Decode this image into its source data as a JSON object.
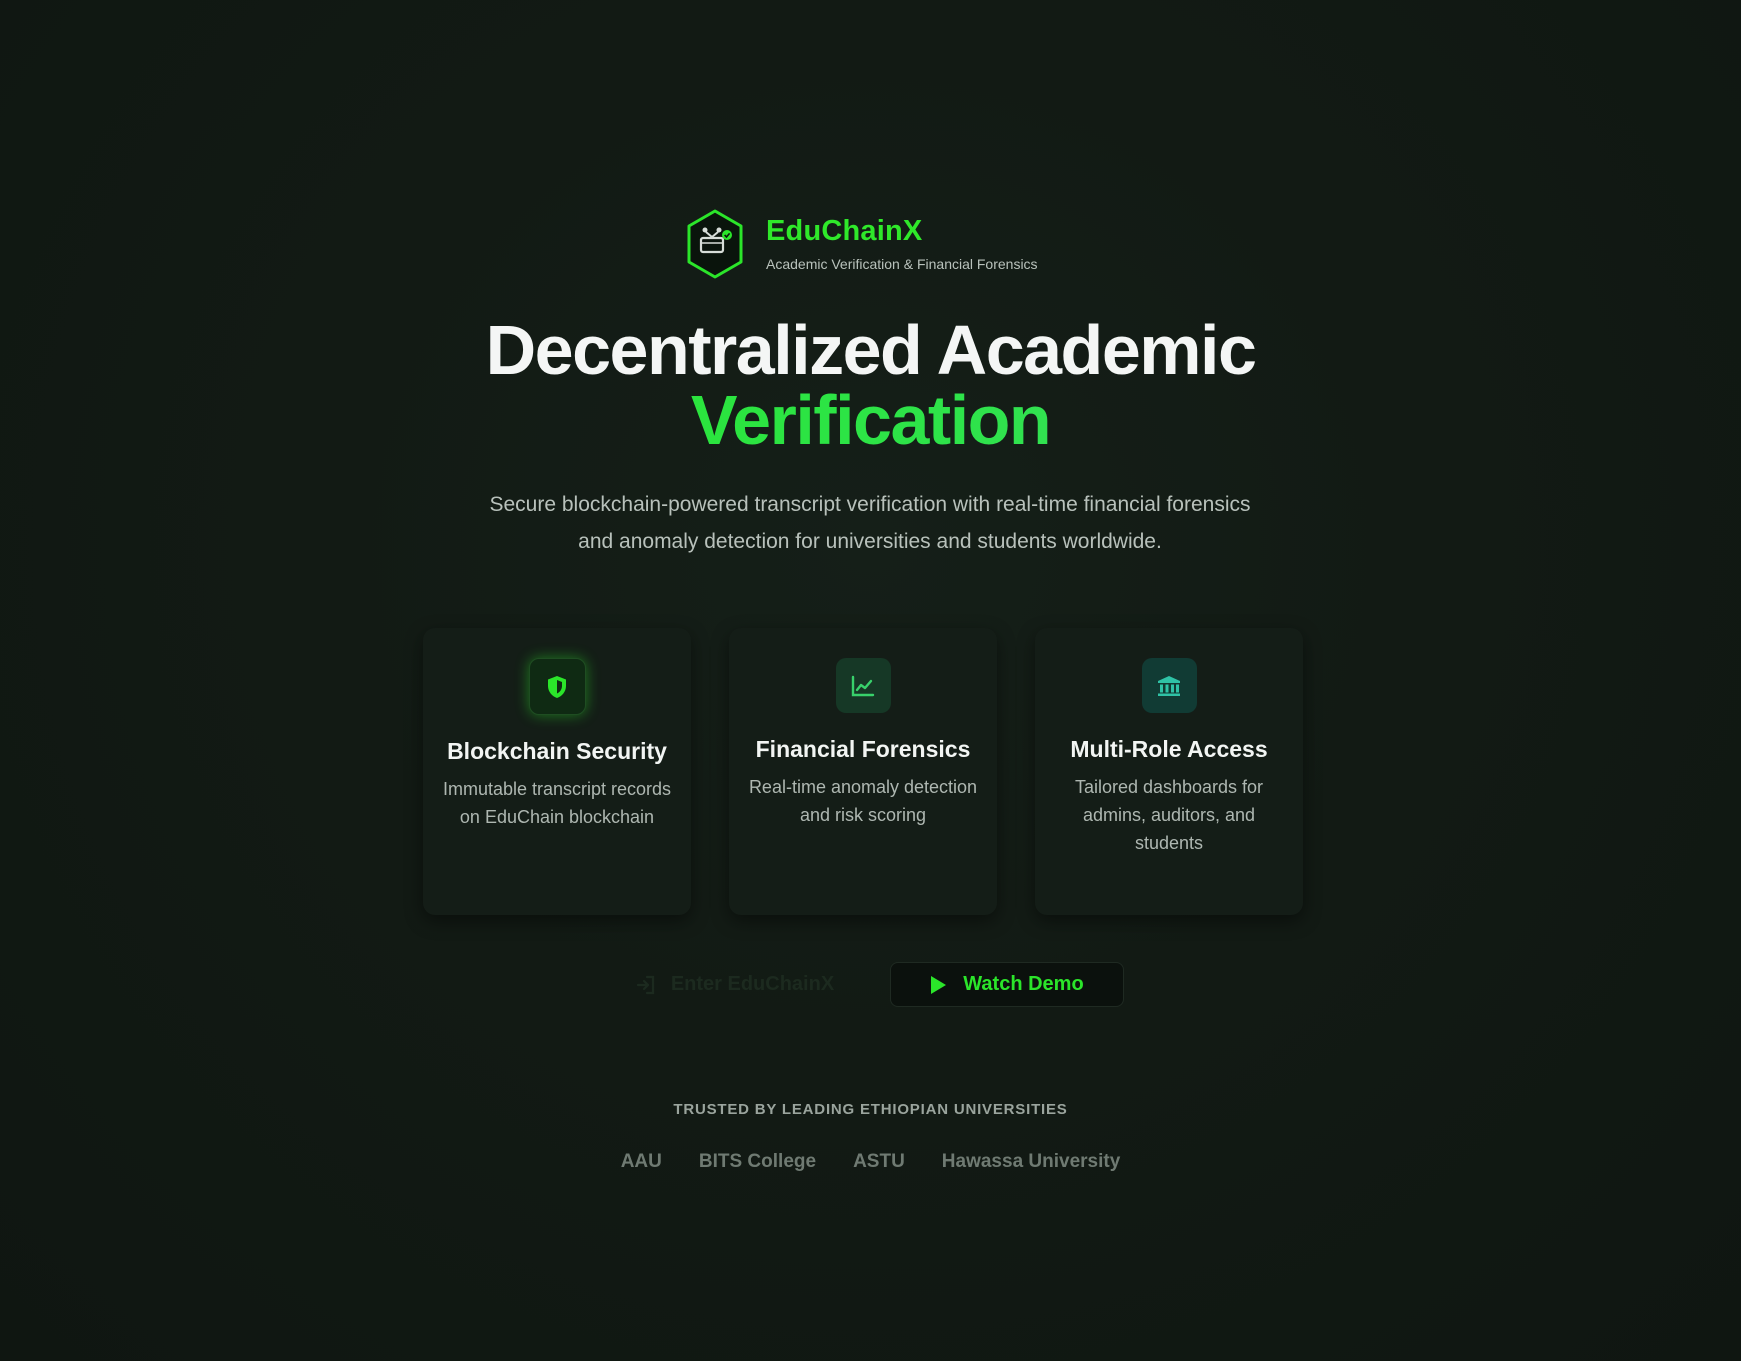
{
  "brand": {
    "name": "EduChainX",
    "tagline": "Academic Verification & Financial Forensics",
    "logo_icon": "hexagon-chain-icon"
  },
  "hero": {
    "title_line1": "Decentralized Academic",
    "title_line2": "Verification",
    "subtitle": "Secure blockchain-powered transcript verification with real-time financial forensics and anomaly detection for universities and students worldwide."
  },
  "features": [
    {
      "icon": "shield-icon",
      "title": "Blockchain Security",
      "description": "Immutable transcript records on EduChain blockchain"
    },
    {
      "icon": "line-chart-icon",
      "title": "Financial Forensics",
      "description": "Real-time anomaly detection and risk scoring"
    },
    {
      "icon": "bank-icon",
      "title": "Multi-Role Access",
      "description": "Tailored dashboards for admins, auditors, and students"
    }
  ],
  "actions": {
    "enter_label": "Enter EduChainX",
    "enter_icon": "login-icon",
    "demo_label": "Watch Demo",
    "demo_icon": "play-icon"
  },
  "trusted": {
    "label": "TRUSTED BY LEADING ETHIOPIAN UNIVERSITIES",
    "universities": [
      "AAU",
      "BITS College",
      "ASTU",
      "Hawassa University"
    ]
  },
  "colors": {
    "accent": "#2be52a",
    "background": "#121a14",
    "card": "#141d17"
  }
}
